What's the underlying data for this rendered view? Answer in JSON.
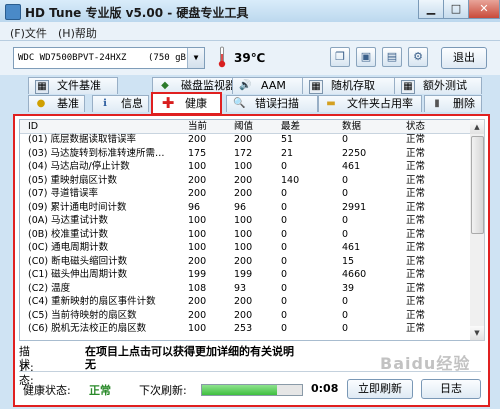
{
  "title": "HD Tune 专业版 v5.00 - 硬盘专业工具",
  "menu": {
    "file": "(F)文件",
    "help": "(H)帮助"
  },
  "toolbar": {
    "disk": "WDC WD7500BPVT-24HXZ",
    "disk_size": "(750 gB)",
    "temperature": "39℃",
    "exit": "退出"
  },
  "tabs_top": [
    "文件基准",
    "磁盘监视器",
    "AAM",
    "随机存取",
    "额外测试"
  ],
  "tabs_bottom": [
    "基准",
    "信息",
    "健康",
    "错误扫描",
    "文件夹占用率",
    "删除"
  ],
  "icons": {
    "tabs_top": [
      "file-benchmark-icon",
      "disk-monitor-icon",
      "aam-icon",
      "random-access-icon",
      "extra-tests-icon"
    ],
    "tabs_bottom": [
      "benchmark-icon",
      "info-icon",
      "health-cross-icon",
      "error-scan-icon",
      "folder-usage-icon",
      "erase-icon"
    ]
  },
  "colors": {
    "active_tab_border": "#e02020",
    "health_cross": "#d81e1e",
    "ok_text": "#2a8a2a",
    "progress": "#3fbf3f"
  },
  "table": {
    "headers": [
      "ID",
      "当前",
      "阈值",
      "最差",
      "数据",
      "状态"
    ],
    "rows": [
      [
        "(01) 底层数据读取错误率",
        "200",
        "200",
        "51",
        "0",
        "正常"
      ],
      [
        "(03) 马达旋转到标准转速所需…",
        "175",
        "172",
        "21",
        "2250",
        "正常"
      ],
      [
        "(04) 马达启动/停止计数",
        "100",
        "100",
        "0",
        "461",
        "正常"
      ],
      [
        "(05) 重映射扇区计数",
        "200",
        "200",
        "140",
        "0",
        "正常"
      ],
      [
        "(07) 寻道错误率",
        "200",
        "200",
        "0",
        "0",
        "正常"
      ],
      [
        "(09) 累计通电时间计数",
        "96",
        "96",
        "0",
        "2991",
        "正常"
      ],
      [
        "(0A) 马达重试计数",
        "100",
        "100",
        "0",
        "0",
        "正常"
      ],
      [
        "(0B) 校准重试计数",
        "100",
        "100",
        "0",
        "0",
        "正常"
      ],
      [
        "(0C) 通电周期计数",
        "100",
        "100",
        "0",
        "461",
        "正常"
      ],
      [
        "(C0) 断电磁头缩回计数",
        "200",
        "200",
        "0",
        "15",
        "正常"
      ],
      [
        "(C1) 磁头伸出周期计数",
        "199",
        "199",
        "0",
        "4660",
        "正常"
      ],
      [
        "(C2) 温度",
        "108",
        "93",
        "0",
        "39",
        "正常"
      ],
      [
        "(C4) 重新映射的扇区事件计数",
        "200",
        "200",
        "0",
        "0",
        "正常"
      ],
      [
        "(C5) 当前待映射的扇区数",
        "200",
        "200",
        "0",
        "0",
        "正常"
      ],
      [
        "(C6) 脱机无法校正的扇区数",
        "100",
        "253",
        "0",
        "0",
        "正常"
      ]
    ]
  },
  "description": {
    "label": "描述:",
    "value": "在项目上点击可以获得更加详细的有关说明"
  },
  "state": {
    "label": "状态:",
    "value": "无"
  },
  "health": {
    "label": "健康状态:",
    "value": "正常"
  },
  "refresh": {
    "label": "下次刷新:",
    "time": "0:08",
    "progress": 0.75
  },
  "buttons": {
    "refresh_now": "立即刷新",
    "log": "日志"
  },
  "watermark": "Baidu经验"
}
